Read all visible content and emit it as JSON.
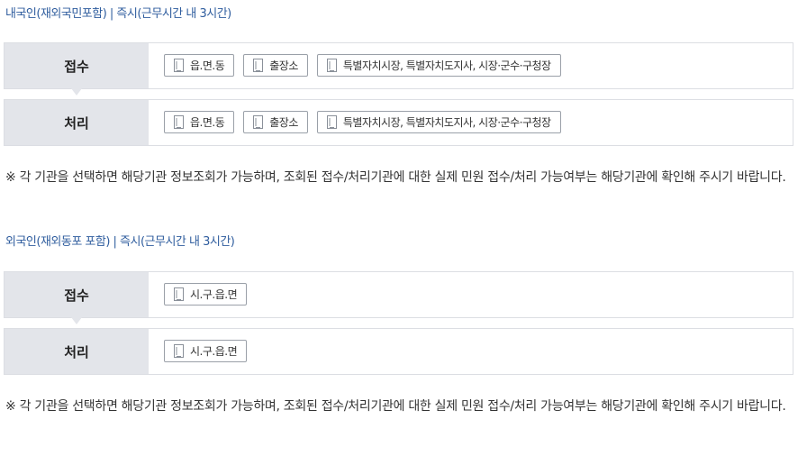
{
  "domestic": {
    "title": "내국인(재외국민포함) | 즉시(근무시간 내 3시간)",
    "receive": {
      "label": "접수",
      "buttons": [
        {
          "label": "읍.면.동",
          "icon": "building-icon"
        },
        {
          "label": "출장소",
          "icon": "building-icon"
        },
        {
          "label": "특별자치시장, 특별자치도지사, 시장·군수·구청장",
          "icon": "building-icon"
        }
      ]
    },
    "process": {
      "label": "처리",
      "buttons": [
        {
          "label": "읍.면.동",
          "icon": "building-icon"
        },
        {
          "label": "출장소",
          "icon": "building-icon"
        },
        {
          "label": "특별자치시장, 특별자치도지사, 시장·군수·구청장",
          "icon": "building-icon"
        }
      ]
    },
    "notice": "※ 각 기관을 선택하면 해당기관 정보조회가 가능하며, 조회된 접수/처리기관에 대한 실제 민원 접수/처리 가능여부는 해당기관에 확인해 주시기 바랍니다."
  },
  "foreign": {
    "title": "외국인(재외동포 포함) | 즉시(근무시간 내 3시간)",
    "receive": {
      "label": "접수",
      "buttons": [
        {
          "label": "시.구.읍.면",
          "icon": "building-icon"
        }
      ]
    },
    "process": {
      "label": "처리",
      "buttons": [
        {
          "label": "시.구.읍.면",
          "icon": "building-icon"
        }
      ]
    },
    "notice": "※ 각 기관을 선택하면 해당기관 정보조회가 가능하며, 조회된 접수/처리기관에 대한 실제 민원 접수/처리 가능여부는 해당기관에 확인해 주시기 바랍니다."
  }
}
